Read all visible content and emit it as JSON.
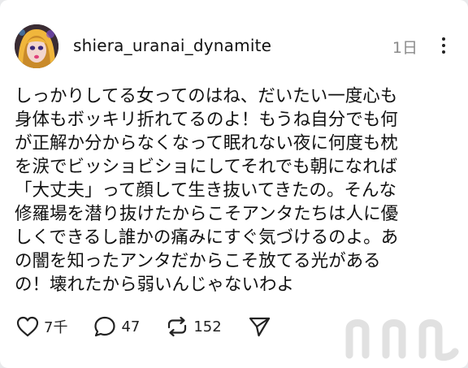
{
  "post": {
    "username": "shiera_uranai_dynamite",
    "timestamp": "1日",
    "text": "しっかりしてる女ってのはね、だいたい一度心も\n身体もボッキリ折れてるのよ！もうね自分でも何\nが正解か分からなくなって眠れない夜に何度も枕\nを涙でビッショビショにしてそれでも朝になれば\n「大丈夫」って顔して生き抜いてきたの。そんな\n修羅場を潜り抜けたからこそアンタたちは人に優\nしくできるし誰かの痛みにすぐ気づけるのよ。あ\nの闇を知ったアンタだからこそ放てる光がある\nの！壊れたから弱いんじゃないわよ"
  },
  "actions": {
    "likes": "7千",
    "comments": "47",
    "reposts": "152"
  },
  "icons": {
    "like": "heart-icon",
    "comment": "comment-bubble-icon",
    "repost": "repost-icon",
    "share": "send-icon",
    "more": "more-vertical-icon"
  },
  "watermark": {
    "text": "nnn"
  }
}
